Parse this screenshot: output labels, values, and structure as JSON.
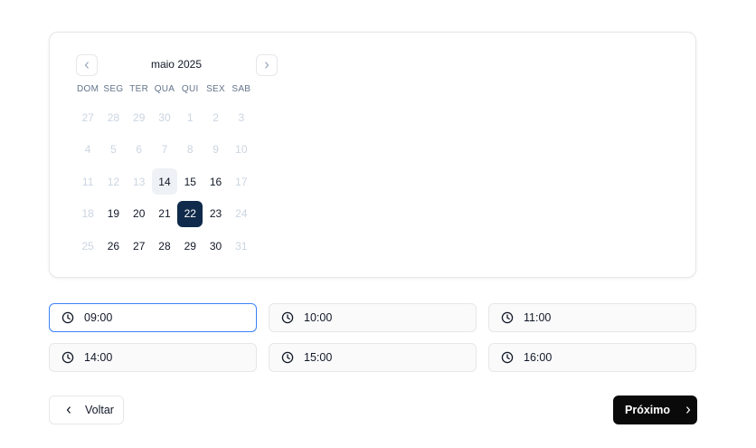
{
  "calendar": {
    "month_label": "maio 2025",
    "weekdays": [
      "DOM",
      "SEG",
      "TER",
      "QUA",
      "QUI",
      "SEX",
      "SAB"
    ],
    "weeks": [
      [
        {
          "d": "27",
          "s": "muted"
        },
        {
          "d": "28",
          "s": "muted"
        },
        {
          "d": "29",
          "s": "muted"
        },
        {
          "d": "30",
          "s": "muted"
        },
        {
          "d": "1",
          "s": "muted"
        },
        {
          "d": "2",
          "s": "muted"
        },
        {
          "d": "3",
          "s": "muted"
        }
      ],
      [
        {
          "d": "4",
          "s": "muted"
        },
        {
          "d": "5",
          "s": "muted"
        },
        {
          "d": "6",
          "s": "muted"
        },
        {
          "d": "7",
          "s": "muted"
        },
        {
          "d": "8",
          "s": "muted"
        },
        {
          "d": "9",
          "s": "muted"
        },
        {
          "d": "10",
          "s": "muted"
        }
      ],
      [
        {
          "d": "11",
          "s": "muted"
        },
        {
          "d": "12",
          "s": "muted"
        },
        {
          "d": "13",
          "s": "muted"
        },
        {
          "d": "14",
          "s": "today"
        },
        {
          "d": "15",
          "s": "active"
        },
        {
          "d": "16",
          "s": "active"
        },
        {
          "d": "17",
          "s": "muted"
        }
      ],
      [
        {
          "d": "18",
          "s": "muted"
        },
        {
          "d": "19",
          "s": "active"
        },
        {
          "d": "20",
          "s": "active"
        },
        {
          "d": "21",
          "s": "active"
        },
        {
          "d": "22",
          "s": "selected"
        },
        {
          "d": "23",
          "s": "active"
        },
        {
          "d": "24",
          "s": "muted"
        }
      ],
      [
        {
          "d": "25",
          "s": "muted"
        },
        {
          "d": "26",
          "s": "active"
        },
        {
          "d": "27",
          "s": "active"
        },
        {
          "d": "28",
          "s": "active"
        },
        {
          "d": "29",
          "s": "active"
        },
        {
          "d": "30",
          "s": "active"
        },
        {
          "d": "31",
          "s": "muted"
        }
      ]
    ],
    "selected_day": "22",
    "prev_icon": "chevron-left-icon",
    "next_icon": "chevron-right-icon"
  },
  "time_slots": [
    {
      "time": "09:00",
      "selected": true
    },
    {
      "time": "10:00",
      "selected": false
    },
    {
      "time": "11:00",
      "selected": false
    },
    {
      "time": "14:00",
      "selected": false
    },
    {
      "time": "15:00",
      "selected": false
    },
    {
      "time": "16:00",
      "selected": false
    }
  ],
  "slot_icon": "clock-icon",
  "buttons": {
    "back_label": "Voltar",
    "next_label": "Próximo"
  },
  "colors": {
    "selected_day_bg": "#0f2a4a",
    "today_bg": "#eef1f5",
    "selected_slot_border": "#3b82f6",
    "primary_button_bg": "#0a0a0a"
  }
}
